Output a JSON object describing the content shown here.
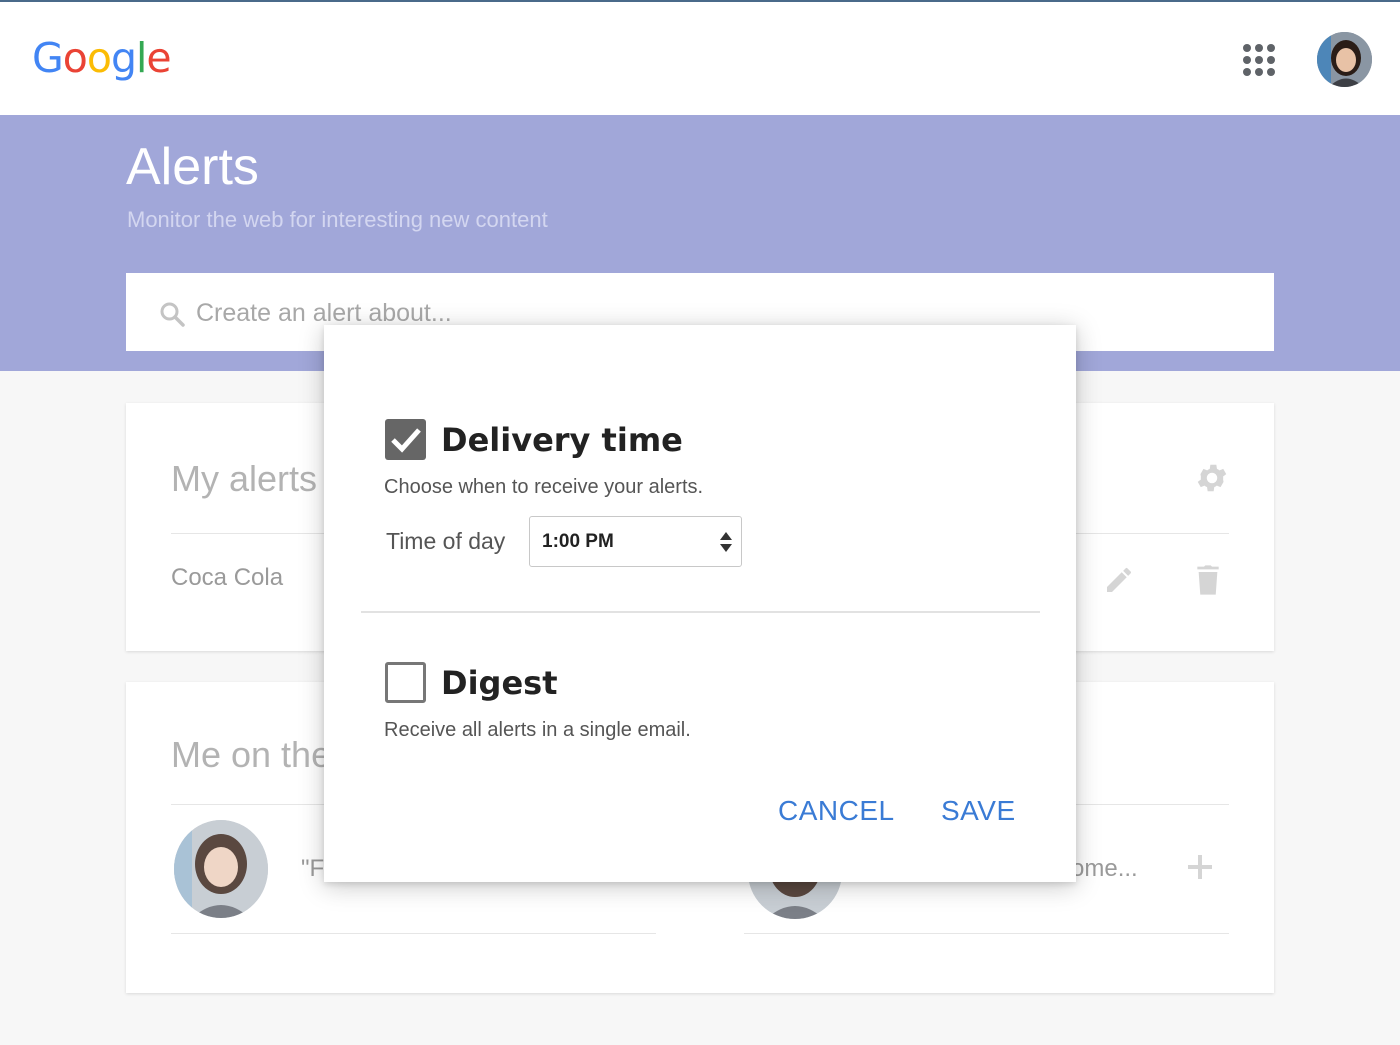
{
  "header": {
    "logo": "Google",
    "apps_icon": "apps-grid-icon",
    "avatar": "user-avatar"
  },
  "hero": {
    "title": "Alerts",
    "subtitle": "Monitor the web for interesting new content",
    "search_placeholder": "Create an alert about..."
  },
  "my_alerts": {
    "title": "My alerts (",
    "items": [
      {
        "label": "Coca Cola"
      }
    ]
  },
  "me_on_web": {
    "title": "Me on the",
    "suggestion_left_text": "\"F",
    "suggestion_right_text": "ome..."
  },
  "dialog": {
    "delivery": {
      "title": "Delivery time",
      "checked": true,
      "description": "Choose when to receive your alerts.",
      "time_label": "Time of day",
      "time_value": "1:00 PM"
    },
    "digest": {
      "title": "Digest",
      "checked": false,
      "description": "Receive all alerts in a single email."
    },
    "cancel_label": "CANCEL",
    "save_label": "SAVE"
  },
  "colors": {
    "hero_bg": "#a1a7d9",
    "accent": "#3a7bd5"
  }
}
